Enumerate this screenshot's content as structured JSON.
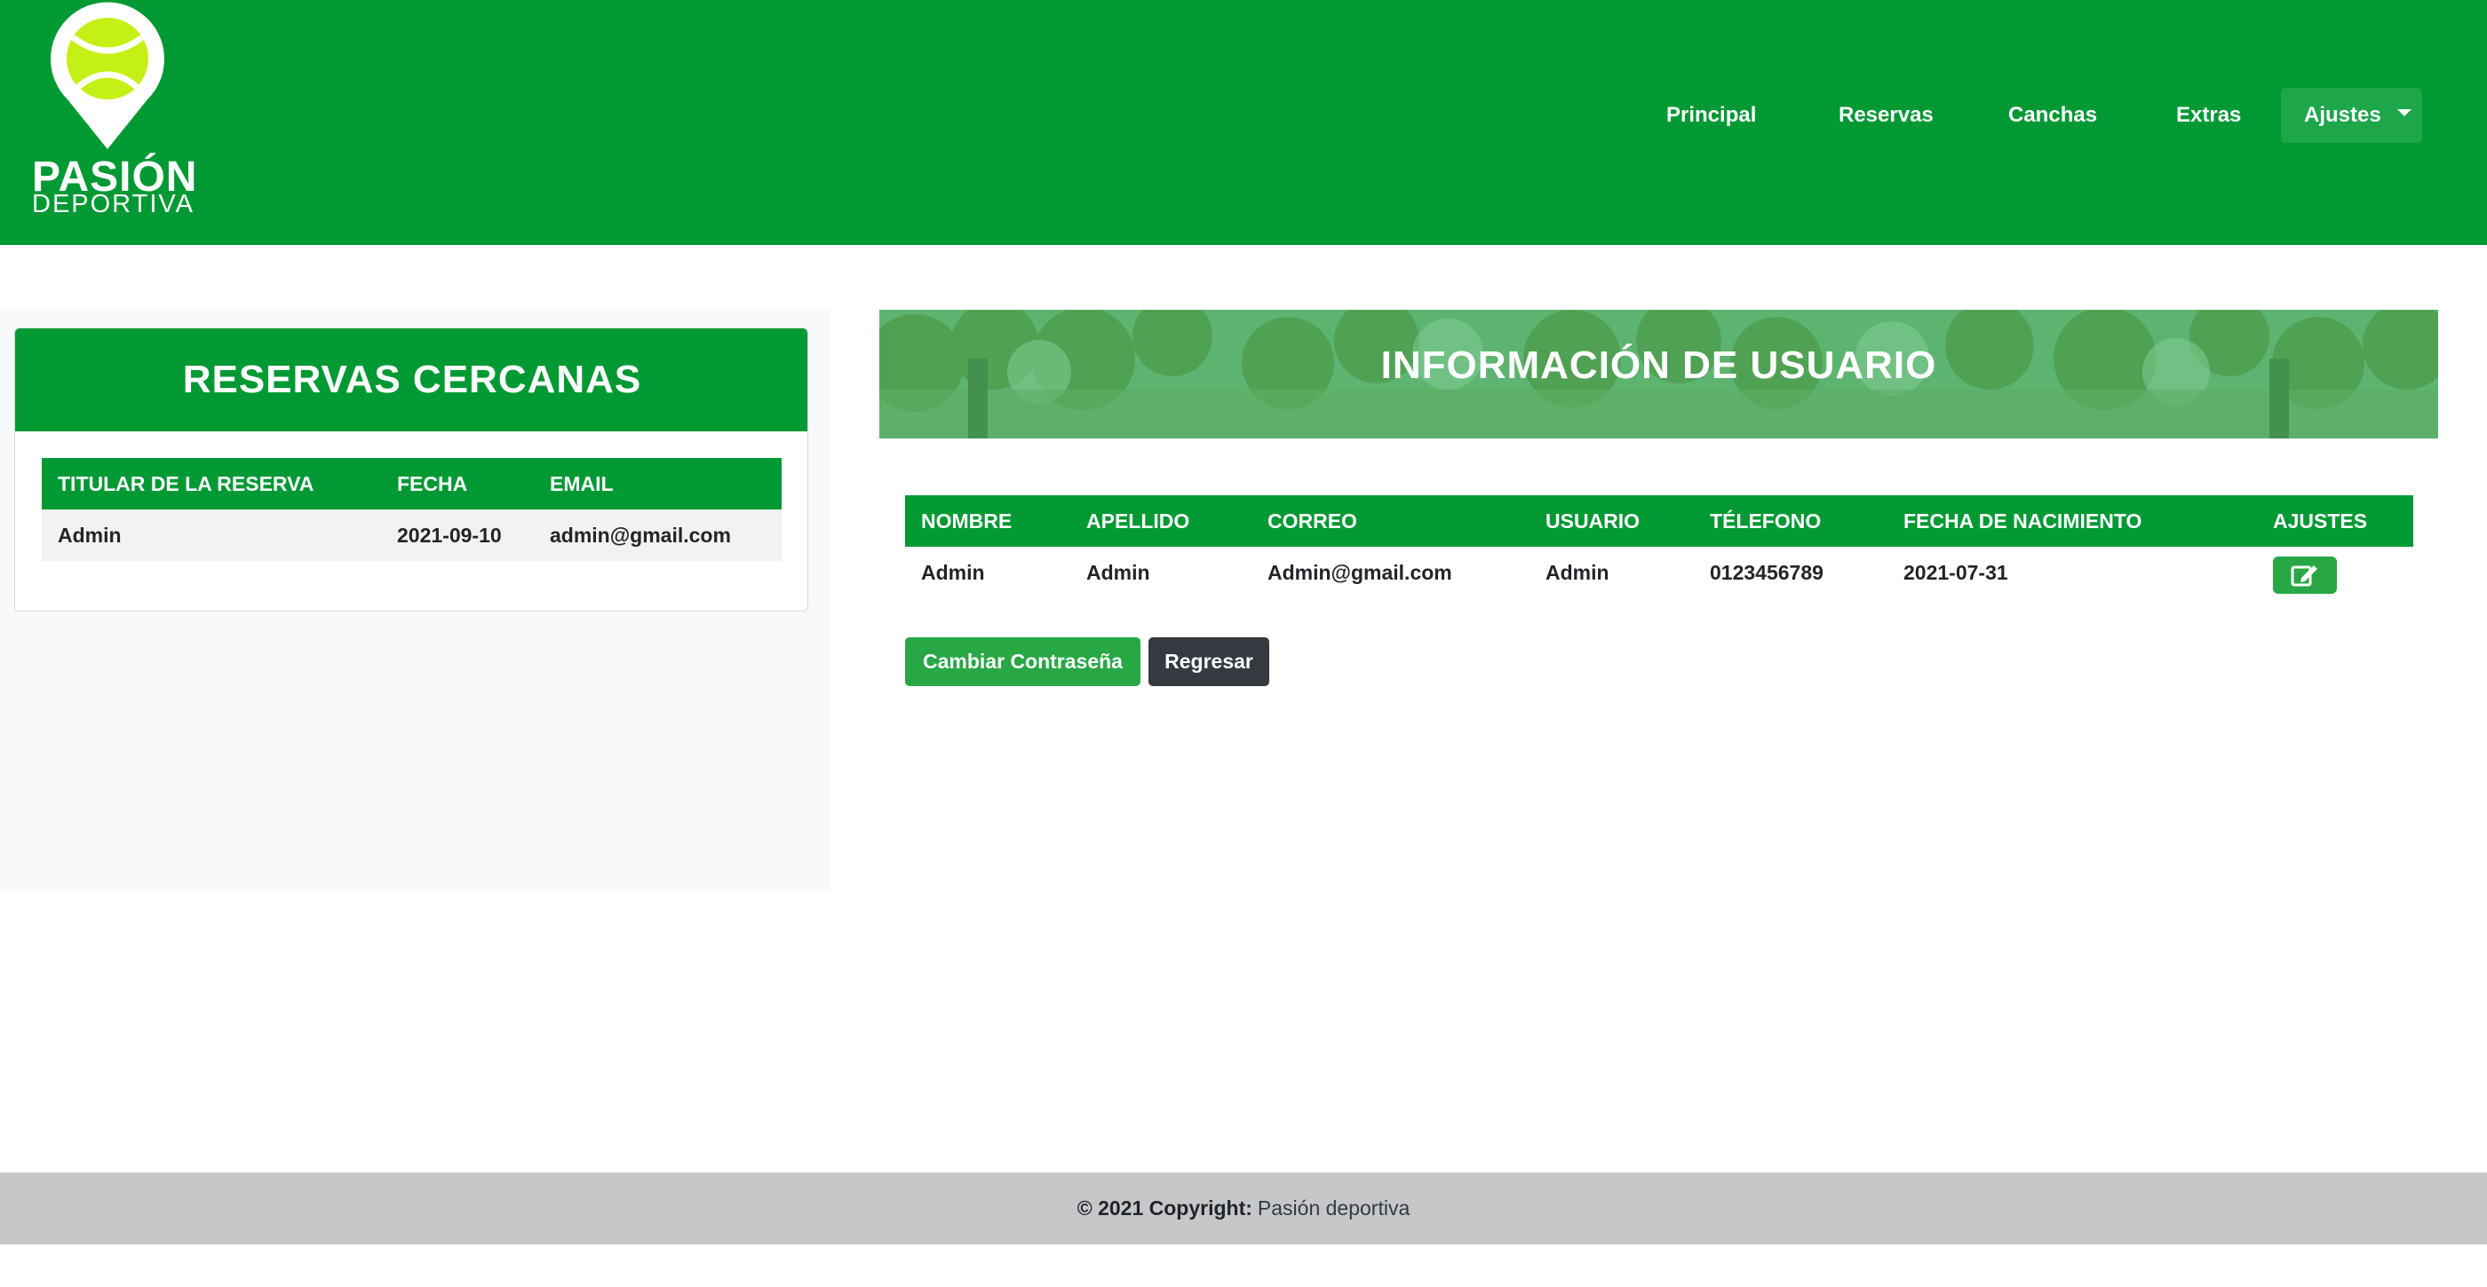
{
  "brand": {
    "title": "PASIÓN",
    "subtitle": "DEPORTIVA"
  },
  "nav": {
    "principal": "Principal",
    "reservas": "Reservas",
    "canchas": "Canchas",
    "extras": "Extras",
    "ajustes": "Ajustes"
  },
  "sidebar": {
    "card_title": "RESERVAS CERCANAS",
    "table": {
      "headers": [
        "TITULAR DE LA RESERVA",
        "FECHA",
        "EMAIL"
      ],
      "rows": [
        [
          "Admin",
          "2021-09-10",
          "admin@gmail.com"
        ]
      ]
    }
  },
  "main": {
    "banner_title": "INFORMACIÓN DE USUARIO",
    "table": {
      "headers": [
        "NOMBRE",
        "APELLIDO",
        "CORREO",
        "USUARIO",
        "TÉLEFONO",
        "FECHA DE NACIMIENTO",
        "AJUSTES"
      ],
      "rows": [
        [
          "Admin",
          "Admin",
          "Admin@gmail.com",
          "Admin",
          "0123456789",
          "2021-07-31"
        ]
      ]
    },
    "buttons": {
      "change_password": "Cambiar Contraseña",
      "back": "Regresar"
    }
  },
  "footer": {
    "copyright": "© 2021 Copyright:",
    "link": "Pasión deportiva"
  },
  "colors": {
    "primary_green": "#019934",
    "button_green": "#28a745",
    "dark": "#343a40",
    "ball_yellow": "#c5f015",
    "footer_gray": "#c6c7c8"
  },
  "icons": {
    "logo": "tennis-ball-pin-icon",
    "edit": "edit-icon",
    "dropdown": "caret-down-icon"
  }
}
